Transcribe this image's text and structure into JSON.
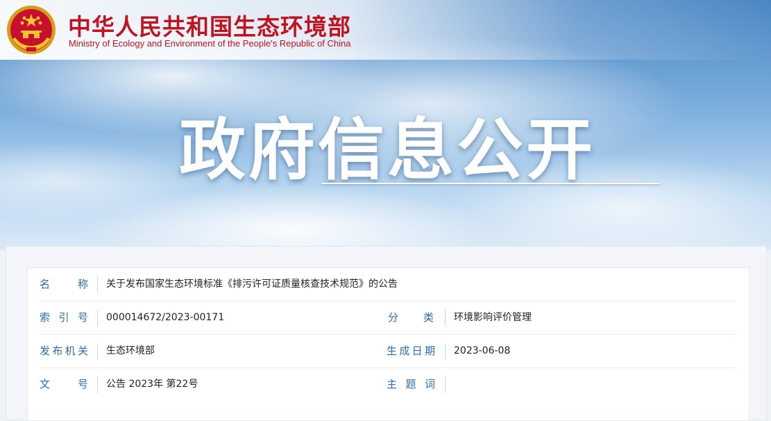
{
  "header": {
    "site_title": "中华人民共和国生态环境部",
    "site_subtitle": "Ministry of Ecology and Environment of the People's Republic of China",
    "emblem_icon": "national-emblem-icon",
    "brand_color": "#c1121f"
  },
  "hero": {
    "title": "政府信息公开"
  },
  "info": {
    "name": {
      "label_chars": [
        "名",
        "称"
      ],
      "value": "关于发布国家生态环境标准《排污许可证质量核查技术规范》的公告"
    },
    "index_no": {
      "label_chars": [
        "索",
        "引",
        "号"
      ],
      "value": "000014672/2023-00171"
    },
    "category": {
      "label_chars": [
        "分",
        "类"
      ],
      "value": "环境影响评价管理"
    },
    "issuer": {
      "label_chars": [
        "发",
        "布",
        "机",
        "关"
      ],
      "value": "生态环境部"
    },
    "date": {
      "label_chars": [
        "生",
        "成",
        "日",
        "期"
      ],
      "value": "2023-06-08"
    },
    "doc_no": {
      "label_chars": [
        "文",
        "号"
      ],
      "value": "公告 2023年 第22号"
    },
    "subject": {
      "label_chars": [
        "主",
        "题",
        "词"
      ],
      "value": ""
    }
  },
  "colors": {
    "label": "#2b6cb0",
    "value": "#222222"
  }
}
